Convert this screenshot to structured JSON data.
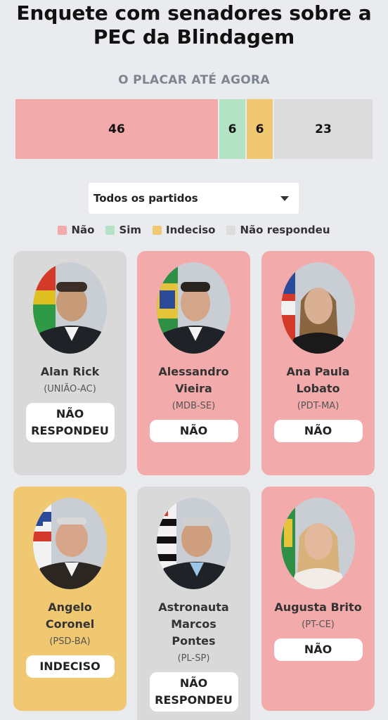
{
  "title": "Enquete com senadores sobre a PEC da Blindagem",
  "subtitle": "O PLACAR ATÉ AGORA",
  "scoreboard": {
    "nao": "46",
    "sim": "6",
    "indeciso": "6",
    "nao_respondeu": "23"
  },
  "filter": {
    "selected": "Todos os partidos"
  },
  "legend": [
    {
      "label": "Não",
      "color": "#f2aaab"
    },
    {
      "label": "Sim",
      "color": "#b3e2c5"
    },
    {
      "label": "Indeciso",
      "color": "#f0c872"
    },
    {
      "label": "Não respondeu",
      "color": "#dcdcdc"
    }
  ],
  "senators": [
    {
      "name_lines": [
        "Alan Rick"
      ],
      "party": "(UNIÃO-AC)",
      "status": "NÃO RESPONDEU",
      "status_lines": [
        "NÃO",
        "RESPONDEU"
      ]
    },
    {
      "name_lines": [
        "Alessandro",
        "Vieira"
      ],
      "party": "(MDB-SE)",
      "status": "NÃO",
      "status_lines": [
        "NÃO"
      ]
    },
    {
      "name_lines": [
        "Ana Paula",
        "Lobato"
      ],
      "party": "(PDT-MA)",
      "status": "NÃO",
      "status_lines": [
        "NÃO"
      ]
    },
    {
      "name_lines": [
        "Angelo",
        "Coronel"
      ],
      "party": "(PSD-BA)",
      "status": "INDECISO",
      "status_lines": [
        "INDECISO"
      ]
    },
    {
      "name_lines": [
        "Astronauta",
        "Marcos",
        "Pontes"
      ],
      "party": "(PL-SP)",
      "status": "NÃO RESPONDEU",
      "status_lines": [
        "NÃO",
        "RESPONDEU"
      ]
    },
    {
      "name_lines": [
        "Augusta Brito"
      ],
      "party": "(PT-CE)",
      "status": "NÃO",
      "status_lines": [
        "NÃO"
      ]
    }
  ],
  "colors": {
    "nao": "#f2aaab",
    "sim": "#b3e2c5",
    "indeciso": "#f0c872",
    "nao_respondeu": "#d9d9d9"
  }
}
